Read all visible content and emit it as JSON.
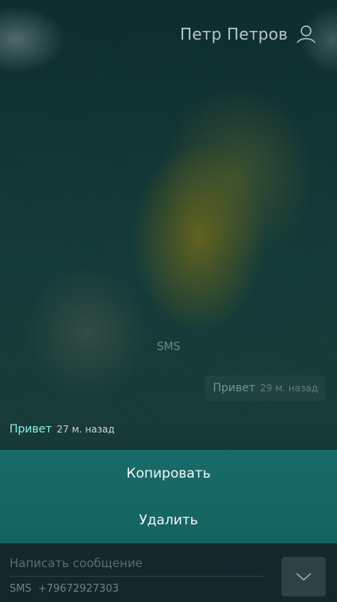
{
  "header": {
    "contact_name": "Петр Петров",
    "avatar_icon": "person-icon"
  },
  "conversation": {
    "channel_label": "SMS",
    "messages": [
      {
        "direction": "out",
        "text": "Привет",
        "time": "29 м. назад"
      },
      {
        "direction": "in",
        "text": "Привет",
        "time": "27 м. назад"
      }
    ]
  },
  "context_menu": {
    "items": [
      {
        "label": "Копировать"
      },
      {
        "label": "Удалить"
      }
    ]
  },
  "composer": {
    "placeholder": "Написать сообщение",
    "channel": "SMS",
    "phone": "+79672927303",
    "expand_icon": "chevron-down-icon"
  },
  "colors": {
    "accent": "#1a6b68",
    "incoming_text": "#8ff0e2"
  }
}
